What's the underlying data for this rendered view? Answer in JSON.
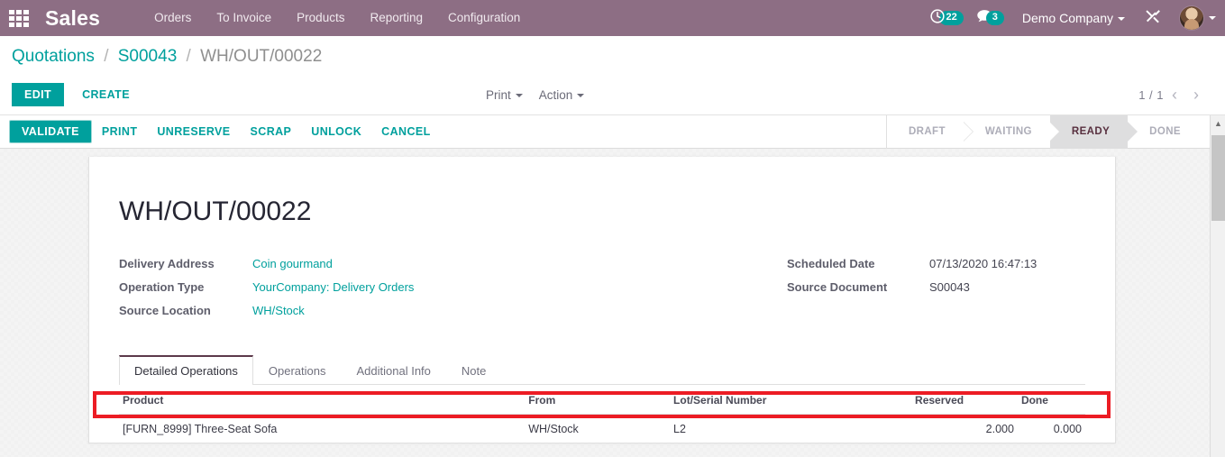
{
  "navbar": {
    "apps_icon": "apps-grid-icon",
    "brand": "Sales",
    "menu": [
      {
        "label": "Orders"
      },
      {
        "label": "To Invoice"
      },
      {
        "label": "Products"
      },
      {
        "label": "Reporting"
      },
      {
        "label": "Configuration"
      }
    ],
    "activity": {
      "icon": "clock-icon",
      "count": "22"
    },
    "messages": {
      "icon": "chat-bubble-icon",
      "count": "3"
    },
    "company": "Demo Company",
    "tools_icon": "wrench-screwdriver-icon",
    "avatar": "user-avatar",
    "bg_color": "#8d6e84"
  },
  "breadcrumb": {
    "items": [
      {
        "label": "Quotations",
        "type": "link"
      },
      {
        "label": "S00043",
        "type": "link"
      },
      {
        "label": "WH/OUT/00022",
        "type": "current"
      }
    ],
    "separator": "/"
  },
  "control_panel": {
    "edit_label": "EDIT",
    "create_label": "CREATE",
    "print_label": "Print",
    "action_label": "Action",
    "pager": {
      "count": "1 / 1",
      "prev_icon": "chevron-left-icon",
      "next_icon": "chevron-right-icon"
    }
  },
  "statusbar_row": {
    "buttons": [
      {
        "label": "VALIDATE",
        "style": "primary"
      },
      {
        "label": "PRINT",
        "style": "link"
      },
      {
        "label": "UNRESERVE",
        "style": "link"
      },
      {
        "label": "SCRAP",
        "style": "link"
      },
      {
        "label": "UNLOCK",
        "style": "link"
      },
      {
        "label": "CANCEL",
        "style": "link"
      }
    ],
    "stages": [
      {
        "label": "DRAFT",
        "active": false
      },
      {
        "label": "WAITING",
        "active": false
      },
      {
        "label": "READY",
        "active": true
      },
      {
        "label": "DONE",
        "active": false
      }
    ]
  },
  "scrollbar": {
    "up_arrow": "chevron-up-icon"
  },
  "form": {
    "title": "WH/OUT/00022",
    "fields_left": [
      {
        "label": "Delivery Address",
        "value": "Coin gourmand",
        "link": true
      },
      {
        "label": "Operation Type",
        "value": "YourCompany: Delivery Orders",
        "link": true
      },
      {
        "label": "Source Location",
        "value": "WH/Stock",
        "link": true
      }
    ],
    "fields_right": [
      {
        "label": "Scheduled Date",
        "value": "07/13/2020 16:47:13",
        "link": false
      },
      {
        "label": "Source Document",
        "value": "S00043",
        "link": false
      }
    ],
    "tabs": [
      {
        "label": "Detailed Operations",
        "active": true
      },
      {
        "label": "Operations",
        "active": false
      },
      {
        "label": "Additional Info",
        "active": false
      },
      {
        "label": "Note",
        "active": false
      }
    ],
    "table": {
      "headers": [
        {
          "label": "Product",
          "align": "left"
        },
        {
          "label": "From",
          "align": "left"
        },
        {
          "label": "Lot/Serial Number",
          "align": "left"
        },
        {
          "label": "Reserved",
          "align": "right"
        },
        {
          "label": "Done",
          "align": "right"
        }
      ],
      "rows": [
        {
          "product": "[FURN_8999] Three-Seat Sofa",
          "from": "WH/Stock",
          "lot": "L2",
          "reserved": "2.000",
          "done": "0.000"
        }
      ]
    }
  },
  "annotation": {
    "highlight_color": "#ec1c24"
  }
}
